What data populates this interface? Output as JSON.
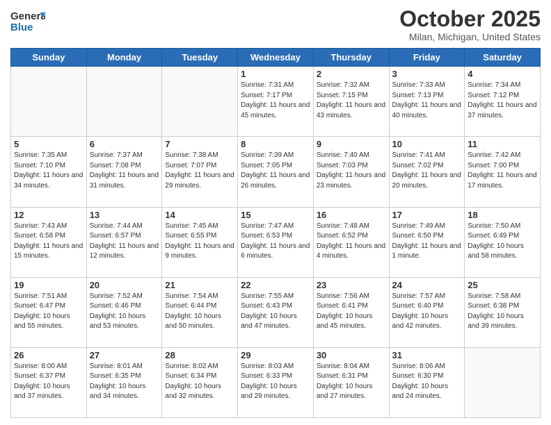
{
  "header": {
    "logo_line1": "General",
    "logo_line2": "Blue",
    "month": "October 2025",
    "location": "Milan, Michigan, United States"
  },
  "days_of_week": [
    "Sunday",
    "Monday",
    "Tuesday",
    "Wednesday",
    "Thursday",
    "Friday",
    "Saturday"
  ],
  "weeks": [
    [
      {
        "day": "",
        "info": ""
      },
      {
        "day": "",
        "info": ""
      },
      {
        "day": "",
        "info": ""
      },
      {
        "day": "1",
        "info": "Sunrise: 7:31 AM\nSunset: 7:17 PM\nDaylight: 11 hours and 45 minutes."
      },
      {
        "day": "2",
        "info": "Sunrise: 7:32 AM\nSunset: 7:15 PM\nDaylight: 11 hours and 43 minutes."
      },
      {
        "day": "3",
        "info": "Sunrise: 7:33 AM\nSunset: 7:13 PM\nDaylight: 11 hours and 40 minutes."
      },
      {
        "day": "4",
        "info": "Sunrise: 7:34 AM\nSunset: 7:12 PM\nDaylight: 11 hours and 37 minutes."
      }
    ],
    [
      {
        "day": "5",
        "info": "Sunrise: 7:35 AM\nSunset: 7:10 PM\nDaylight: 11 hours and 34 minutes."
      },
      {
        "day": "6",
        "info": "Sunrise: 7:37 AM\nSunset: 7:08 PM\nDaylight: 11 hours and 31 minutes."
      },
      {
        "day": "7",
        "info": "Sunrise: 7:38 AM\nSunset: 7:07 PM\nDaylight: 11 hours and 29 minutes."
      },
      {
        "day": "8",
        "info": "Sunrise: 7:39 AM\nSunset: 7:05 PM\nDaylight: 11 hours and 26 minutes."
      },
      {
        "day": "9",
        "info": "Sunrise: 7:40 AM\nSunset: 7:03 PM\nDaylight: 11 hours and 23 minutes."
      },
      {
        "day": "10",
        "info": "Sunrise: 7:41 AM\nSunset: 7:02 PM\nDaylight: 11 hours and 20 minutes."
      },
      {
        "day": "11",
        "info": "Sunrise: 7:42 AM\nSunset: 7:00 PM\nDaylight: 11 hours and 17 minutes."
      }
    ],
    [
      {
        "day": "12",
        "info": "Sunrise: 7:43 AM\nSunset: 6:58 PM\nDaylight: 11 hours and 15 minutes."
      },
      {
        "day": "13",
        "info": "Sunrise: 7:44 AM\nSunset: 6:57 PM\nDaylight: 11 hours and 12 minutes."
      },
      {
        "day": "14",
        "info": "Sunrise: 7:45 AM\nSunset: 6:55 PM\nDaylight: 11 hours and 9 minutes."
      },
      {
        "day": "15",
        "info": "Sunrise: 7:47 AM\nSunset: 6:53 PM\nDaylight: 11 hours and 6 minutes."
      },
      {
        "day": "16",
        "info": "Sunrise: 7:48 AM\nSunset: 6:52 PM\nDaylight: 11 hours and 4 minutes."
      },
      {
        "day": "17",
        "info": "Sunrise: 7:49 AM\nSunset: 6:50 PM\nDaylight: 11 hours and 1 minute."
      },
      {
        "day": "18",
        "info": "Sunrise: 7:50 AM\nSunset: 6:49 PM\nDaylight: 10 hours and 58 minutes."
      }
    ],
    [
      {
        "day": "19",
        "info": "Sunrise: 7:51 AM\nSunset: 6:47 PM\nDaylight: 10 hours and 55 minutes."
      },
      {
        "day": "20",
        "info": "Sunrise: 7:52 AM\nSunset: 6:46 PM\nDaylight: 10 hours and 53 minutes."
      },
      {
        "day": "21",
        "info": "Sunrise: 7:54 AM\nSunset: 6:44 PM\nDaylight: 10 hours and 50 minutes."
      },
      {
        "day": "22",
        "info": "Sunrise: 7:55 AM\nSunset: 6:43 PM\nDaylight: 10 hours and 47 minutes."
      },
      {
        "day": "23",
        "info": "Sunrise: 7:56 AM\nSunset: 6:41 PM\nDaylight: 10 hours and 45 minutes."
      },
      {
        "day": "24",
        "info": "Sunrise: 7:57 AM\nSunset: 6:40 PM\nDaylight: 10 hours and 42 minutes."
      },
      {
        "day": "25",
        "info": "Sunrise: 7:58 AM\nSunset: 6:38 PM\nDaylight: 10 hours and 39 minutes."
      }
    ],
    [
      {
        "day": "26",
        "info": "Sunrise: 8:00 AM\nSunset: 6:37 PM\nDaylight: 10 hours and 37 minutes."
      },
      {
        "day": "27",
        "info": "Sunrise: 8:01 AM\nSunset: 6:35 PM\nDaylight: 10 hours and 34 minutes."
      },
      {
        "day": "28",
        "info": "Sunrise: 8:02 AM\nSunset: 6:34 PM\nDaylight: 10 hours and 32 minutes."
      },
      {
        "day": "29",
        "info": "Sunrise: 8:03 AM\nSunset: 6:33 PM\nDaylight: 10 hours and 29 minutes."
      },
      {
        "day": "30",
        "info": "Sunrise: 8:04 AM\nSunset: 6:31 PM\nDaylight: 10 hours and 27 minutes."
      },
      {
        "day": "31",
        "info": "Sunrise: 8:06 AM\nSunset: 6:30 PM\nDaylight: 10 hours and 24 minutes."
      },
      {
        "day": "",
        "info": ""
      }
    ]
  ]
}
